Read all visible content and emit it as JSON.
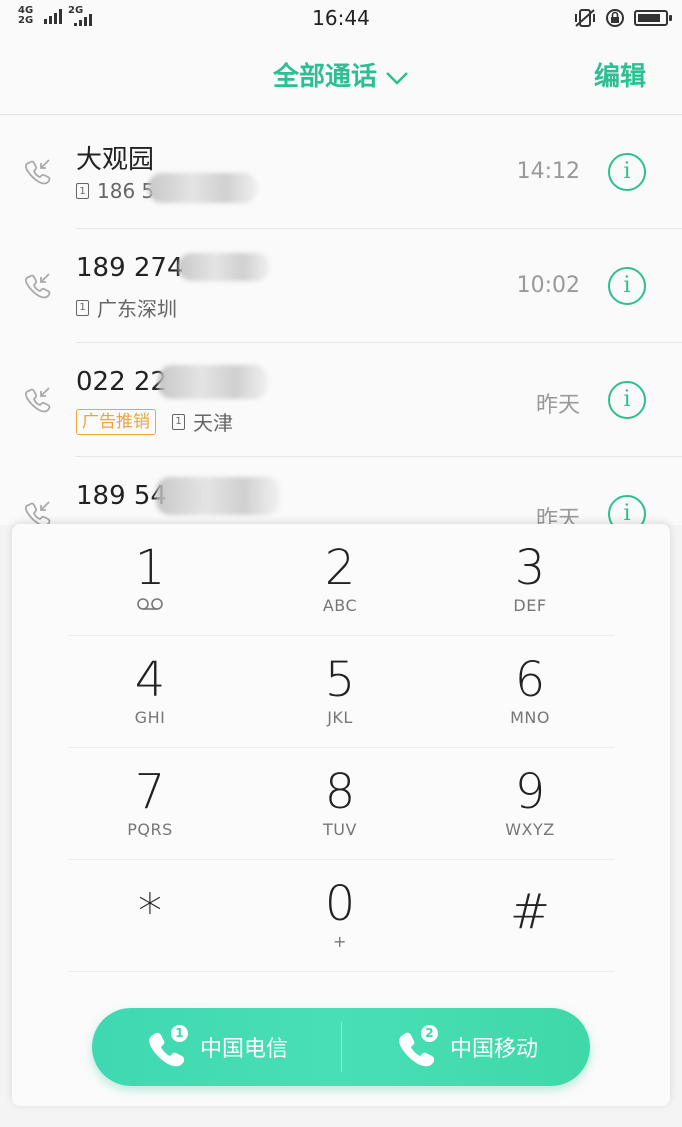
{
  "status_bar": {
    "net_top": "4G",
    "net_bottom": "2G",
    "net_second": "2G",
    "time": "16:44"
  },
  "header": {
    "title": "全部通话",
    "edit": "编辑"
  },
  "calls": [
    {
      "name": "大观园",
      "number": "186 5",
      "location": "",
      "ad_tag": "",
      "time": "14:12"
    },
    {
      "name": "189 274",
      "number": "",
      "location": "广东深圳",
      "ad_tag": "",
      "time": "10:02"
    },
    {
      "name": "022 22",
      "number": "",
      "location": "天津",
      "ad_tag": "广告推销",
      "time": "昨天"
    },
    {
      "name": "189 54",
      "number": "",
      "location": "",
      "ad_tag": "",
      "time": "昨天"
    }
  ],
  "info_glyph": "i",
  "sim_glyph": "1",
  "dialpad": {
    "rows": [
      [
        {
          "num": "1",
          "letters": ""
        },
        {
          "num": "2",
          "letters": "ABC"
        },
        {
          "num": "3",
          "letters": "DEF"
        }
      ],
      [
        {
          "num": "4",
          "letters": "GHI"
        },
        {
          "num": "5",
          "letters": "JKL"
        },
        {
          "num": "6",
          "letters": "MNO"
        }
      ],
      [
        {
          "num": "7",
          "letters": "PQRS"
        },
        {
          "num": "8",
          "letters": "TUV"
        },
        {
          "num": "9",
          "letters": "WXYZ"
        }
      ],
      [
        {
          "num": "*",
          "letters": ""
        },
        {
          "num": "0",
          "letters": "+"
        },
        {
          "num": "#",
          "letters": ""
        }
      ]
    ]
  },
  "call_buttons": [
    {
      "sim": "1",
      "label": "中国电信"
    },
    {
      "sim": "2",
      "label": "中国移动"
    }
  ],
  "colors": {
    "accent": "#2dbf92",
    "ad_tag": "#f0a43a",
    "call_bar": "#45dcb2"
  },
  "battery_level": 0.85
}
